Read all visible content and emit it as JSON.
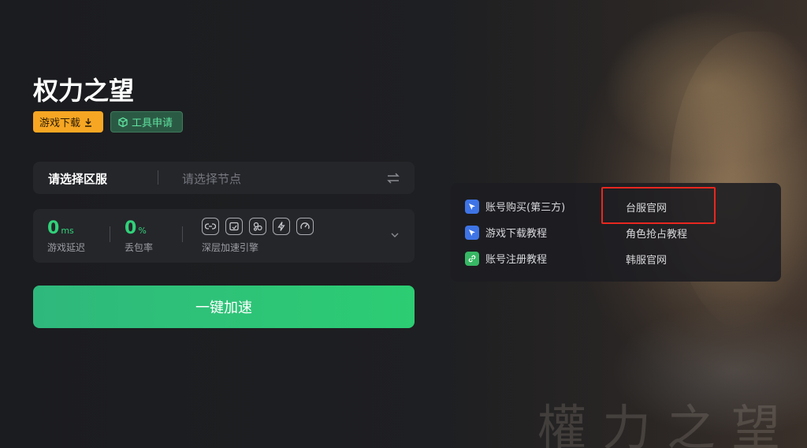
{
  "game": {
    "title": "权力之望",
    "watermark_text": "權力之望"
  },
  "tags": {
    "download_label": "游戏下载",
    "tool_label": "工具申请"
  },
  "server": {
    "region_label": "请选择区服",
    "node_placeholder": "请选择节点"
  },
  "stats": {
    "latency_value": "0",
    "latency_unit": "ms",
    "latency_label": "游戏延迟",
    "loss_value": "0",
    "loss_unit": "%",
    "loss_label": "丢包率",
    "engine_label": "深层加速引擎"
  },
  "accelerate_button": "一键加速",
  "links": {
    "account_purchase": "账号购买(第三方)",
    "download_tutorial": "游戏下载教程",
    "register_tutorial": "账号注册教程",
    "tw_official": "台服官网",
    "role_tutorial": "角色抢占教程",
    "kr_official": "韩服官网"
  },
  "colors": {
    "accent_green": "#31d17a",
    "download_tag": "#f6a623",
    "highlight_red": "#e8271f"
  }
}
